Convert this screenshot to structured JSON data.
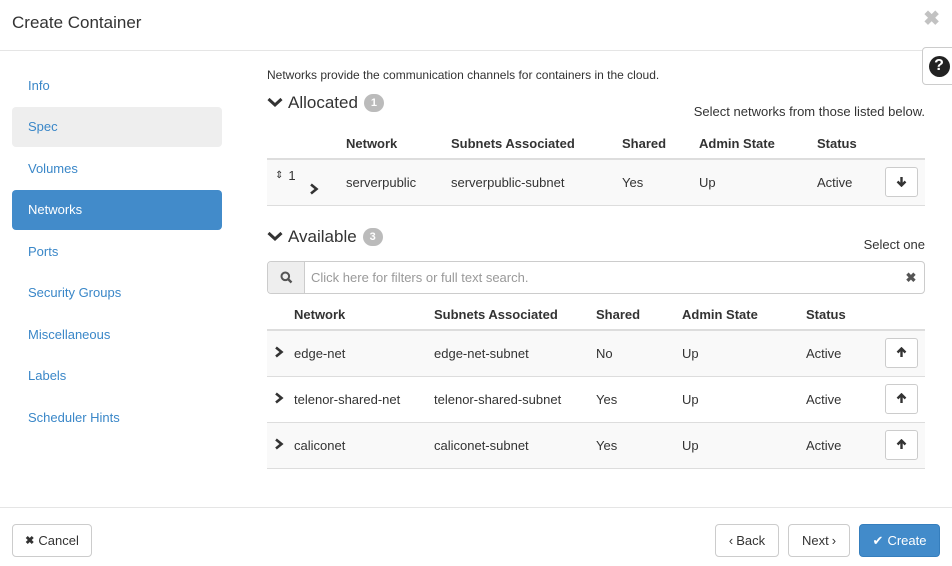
{
  "header": {
    "title": "Create Container",
    "close_icon": "close-icon",
    "help_icon": "question-circle-icon",
    "help_glyph": "?"
  },
  "sidebar": {
    "items": [
      {
        "label": "Info",
        "state": "default"
      },
      {
        "label": "Spec",
        "state": "visited"
      },
      {
        "label": "Volumes",
        "state": "default"
      },
      {
        "label": "Networks",
        "state": "active"
      },
      {
        "label": "Ports",
        "state": "default"
      },
      {
        "label": "Security Groups",
        "state": "default"
      },
      {
        "label": "Miscellaneous",
        "state": "default"
      },
      {
        "label": "Labels",
        "state": "default"
      },
      {
        "label": "Scheduler Hints",
        "state": "default"
      }
    ]
  },
  "main": {
    "intro": "Networks provide the communication channels for containers in the cloud.",
    "allocated": {
      "title": "Allocated",
      "count": "1",
      "hint": "Select networks from those listed below.",
      "columns": [
        "Network",
        "Subnets Associated",
        "Shared",
        "Admin State",
        "Status"
      ],
      "rows": [
        {
          "order": "1",
          "network": "serverpublic",
          "subnets": "serverpublic-subnet",
          "shared": "Yes",
          "admin_state": "Up",
          "status": "Active"
        }
      ]
    },
    "available": {
      "title": "Available",
      "count": "3",
      "hint": "Select one",
      "search_placeholder": "Click here for filters or full text search.",
      "search_value": "",
      "columns": [
        "Network",
        "Subnets Associated",
        "Shared",
        "Admin State",
        "Status"
      ],
      "rows": [
        {
          "network": "edge-net",
          "subnets": "edge-net-subnet",
          "shared": "No",
          "admin_state": "Up",
          "status": "Active"
        },
        {
          "network": "telenor-shared-net",
          "subnets": "telenor-shared-subnet",
          "shared": "Yes",
          "admin_state": "Up",
          "status": "Active"
        },
        {
          "network": "caliconet",
          "subnets": "caliconet-subnet",
          "shared": "Yes",
          "admin_state": "Up",
          "status": "Active"
        }
      ]
    }
  },
  "footer": {
    "cancel_label": "Cancel",
    "back_label": "Back",
    "next_label": "Next",
    "create_label": "Create",
    "primary_color": "#428bca"
  }
}
